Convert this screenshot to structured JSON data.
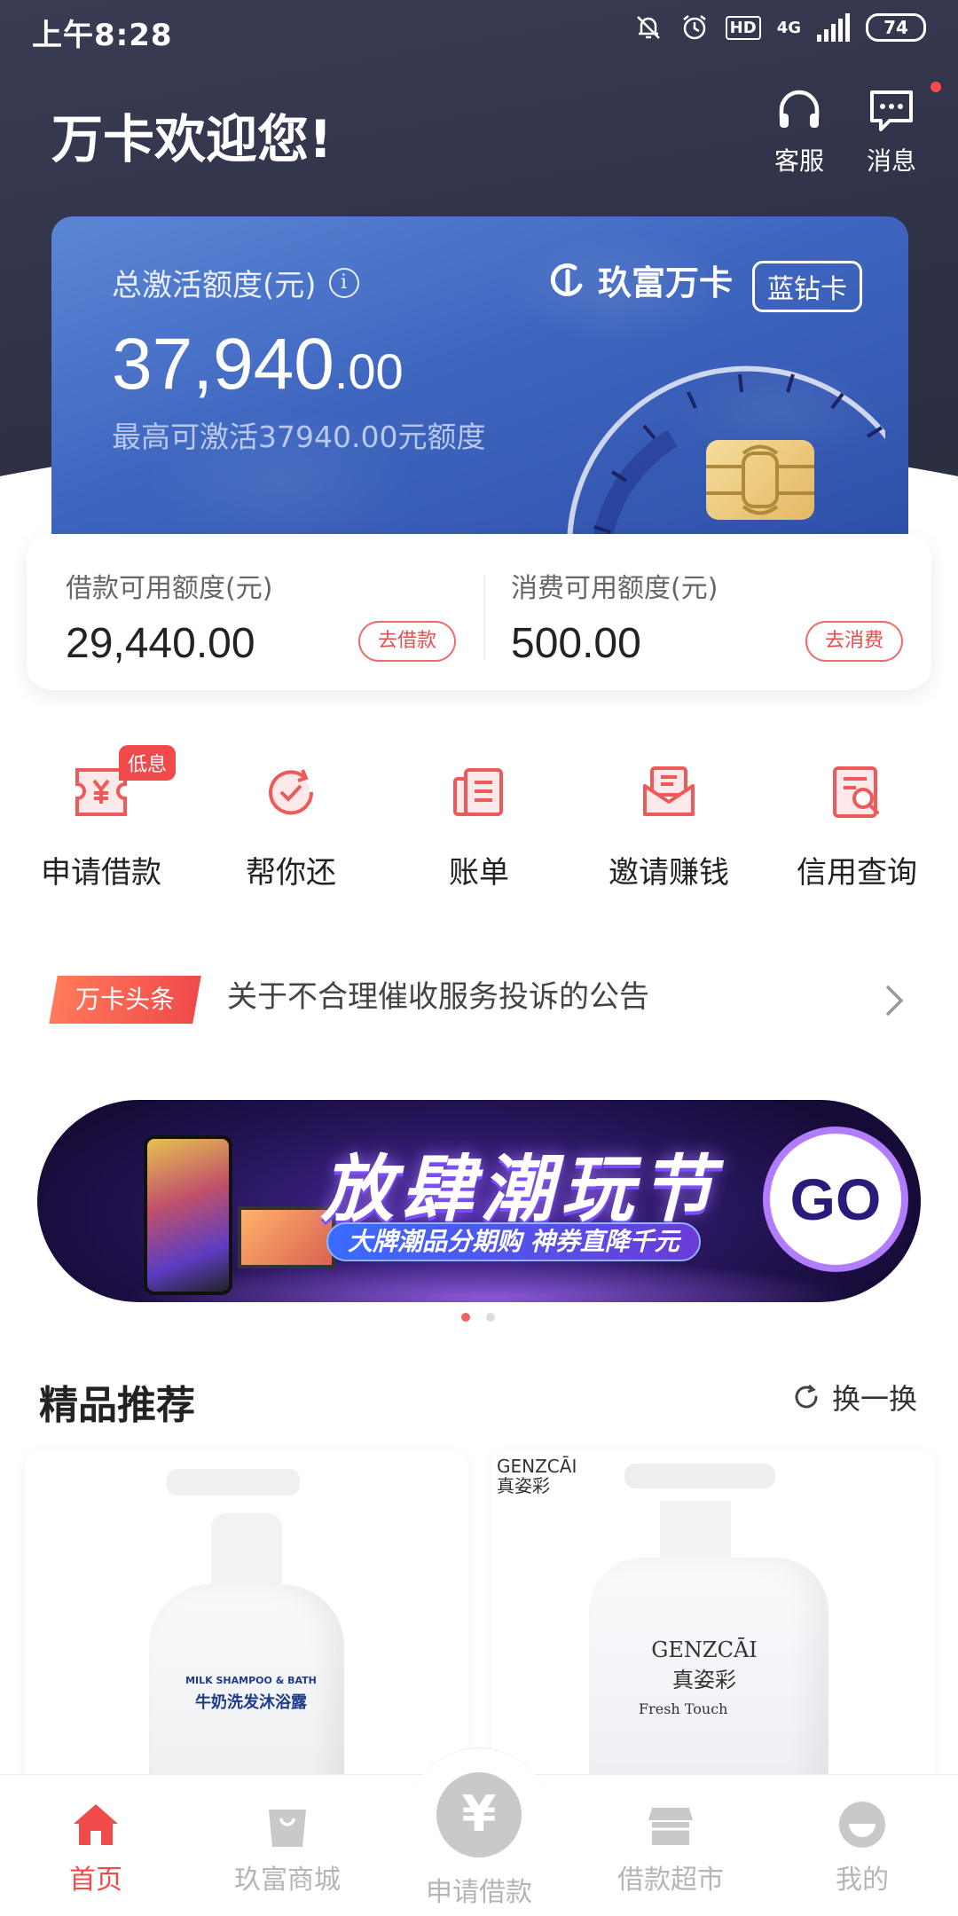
{
  "status_bar": {
    "time": "上午8:28",
    "hd": "HD",
    "network": "4G",
    "battery": "74"
  },
  "header": {
    "greeting": "万卡欢迎您!",
    "service_label": "客服",
    "message_label": "消息"
  },
  "card": {
    "label": "总激活额度(元)",
    "info_icon": "i",
    "brand": "玖富万卡",
    "tier": "蓝钻卡",
    "amount_main": "37,940",
    "amount_cents": ".00",
    "sub": "最高可激活37940.00元额度"
  },
  "balances": {
    "borrow_label": "借款可用额度(元)",
    "borrow_value": "29,440.00",
    "borrow_button": "去借款",
    "spend_label": "消费可用额度(元)",
    "spend_value": "500.00",
    "spend_button": "去消费"
  },
  "quick_actions": [
    {
      "label": "申请借款",
      "icon": "loan-ticket-icon",
      "badge": "低息"
    },
    {
      "label": "帮你还",
      "icon": "repay-check-icon"
    },
    {
      "label": "账单",
      "icon": "bill-icon"
    },
    {
      "label": "邀请赚钱",
      "icon": "invite-envelope-icon"
    },
    {
      "label": "信用查询",
      "icon": "credit-search-icon"
    }
  ],
  "news": {
    "tag": "万卡头条",
    "text": "关于不合理催收服务投诉的公告"
  },
  "banner": {
    "title": "放肆潮玩节",
    "subtitle": "大牌潮品分期购 神券直降千元",
    "go": "GO",
    "page_count": 2,
    "active_page": 1
  },
  "recommend": {
    "title": "精品推荐",
    "refresh": "换一换",
    "products": [
      {
        "tagline": "MILK SHAMPOO & BATH",
        "name": "牛奶洗发沐浴露"
      },
      {
        "brand_en": "GENZCĀI",
        "brand_cn": "真姿彩",
        "line": "Fresh Touch"
      }
    ]
  },
  "bottom_nav": [
    {
      "label": "首页",
      "icon": "home-icon",
      "active": true
    },
    {
      "label": "玖富商城",
      "icon": "shopping-bag-icon"
    },
    {
      "label": "申请借款",
      "icon": "yuan-icon",
      "glyph": "¥"
    },
    {
      "label": "借款超市",
      "icon": "store-icon"
    },
    {
      "label": "我的",
      "icon": "profile-icon"
    }
  ],
  "colors": {
    "accent": "#f04a4a",
    "card_blue": "#3f66bf",
    "header_dark": "#2f3147"
  }
}
